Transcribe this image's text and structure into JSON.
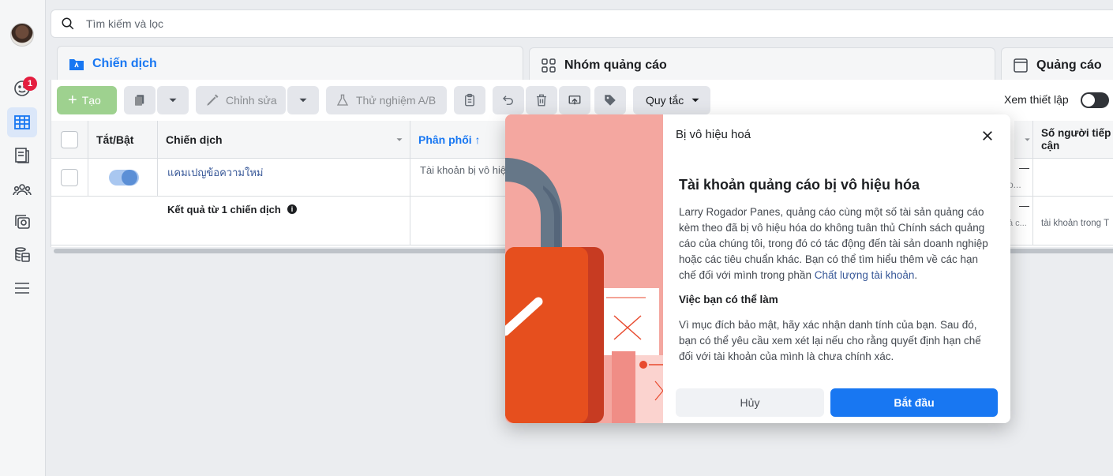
{
  "search": {
    "placeholder": "Tìm kiếm và lọc"
  },
  "rail": {
    "notification_count": "1"
  },
  "tabs": [
    {
      "label": "Chiến dịch",
      "active": true
    },
    {
      "label": "Nhóm quảng cáo",
      "active": false
    },
    {
      "label": "Quảng cáo",
      "active": false
    }
  ],
  "toolbar": {
    "create_label": "Tạo",
    "edit_label": "Chỉnh sửa",
    "ab_test_label": "Thử nghiệm A/B",
    "rules_label": "Quy tắc",
    "view_setup_label": "Xem thiết lập"
  },
  "table": {
    "headers": {
      "toggle": "Tắt/Bật",
      "campaign": "Chiến dịch",
      "delivery": "Phân phối ↑",
      "reach": "Số người tiếp cận"
    },
    "row": {
      "campaign_name": "แคมเปญข้อความใหม่",
      "delivery": "Tài khoản bị vô hiệ",
      "col_dash": "—",
      "col_dash_sub": "o..."
    },
    "summary": {
      "label": "Kết quả từ 1 chiến dịch",
      "col_dash": "—",
      "col_dash_sub": "ả c...",
      "reach_text": "tài khoản trong T"
    }
  },
  "modal": {
    "title": "Bị vô hiệu hoá",
    "heading": "Tài khoản quảng cáo bị vô hiệu hóa",
    "body": "Larry Rogador Panes, quảng cáo cùng một số tài sản quảng cáo kèm theo đã bị vô hiệu hóa do không tuân thủ Chính sách quảng cáo của chúng tôi, trong đó có tác động đến tài sản doanh nghiệp hoặc các tiêu chuẩn khác. Bạn có thể tìm hiểu thêm về các hạn chế đối với mình trong phần ",
    "link_text": "Chất lượng tài khoản",
    "body_end": ".",
    "subheading": "Việc bạn có thể làm",
    "body2": "Vì mục đích bảo mật, hãy xác nhận danh tính của bạn. Sau đó, bạn có thể yêu cầu xem xét lại nếu cho rằng quyết định hạn chế đối với tài khoản của mình là chưa chính xác.",
    "cancel_label": "Hủy",
    "start_label": "Bắt đầu"
  },
  "colors": {
    "accent": "#1877f2",
    "danger": "#e41e3f",
    "create": "#9ed18f"
  }
}
